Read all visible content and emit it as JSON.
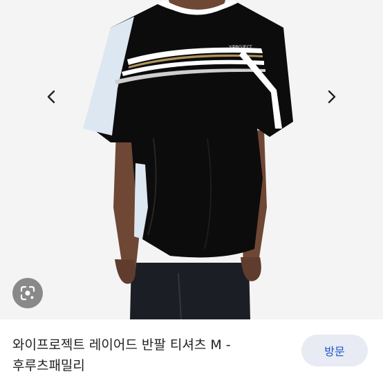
{
  "viewer": {
    "title": "와이프로젝트 레이어드 반팔 티셔츠 M - 후루츠패밀리",
    "visit_label": "방문",
    "prev_icon": "chevron-left-icon",
    "next_icon": "chevron-right-icon",
    "lens_icon": "google-lens-icon"
  },
  "product_image": {
    "chest_logo": "Y/PROJECT",
    "colors": {
      "shirt": "#0c0c0c",
      "panel": "#dde7f1",
      "stripe_white": "#ffffff",
      "stripe_gold": "#b2945a",
      "skin": "#6e4735",
      "jeans": "#1a1c22",
      "background": "#f4f4f4"
    }
  }
}
